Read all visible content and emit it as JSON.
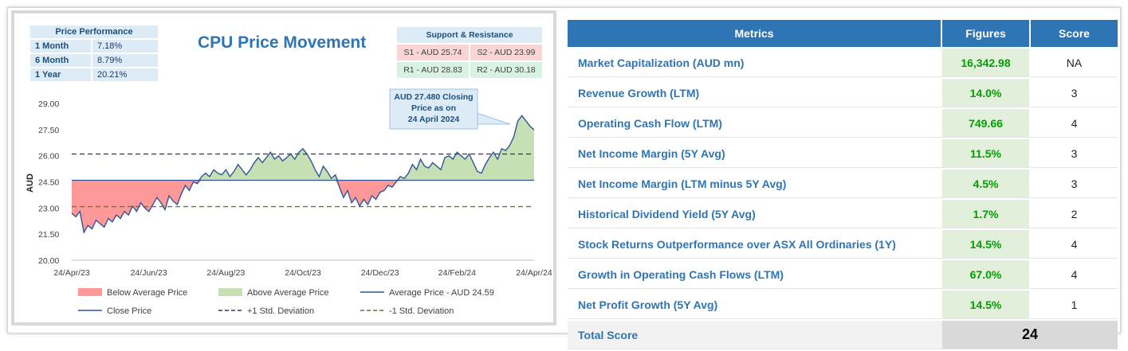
{
  "price_performance": {
    "header": "Price Performance",
    "rows": [
      {
        "label": "1 Month",
        "value": "7.18%"
      },
      {
        "label": "6 Month",
        "value": "8.79%"
      },
      {
        "label": "1 Year",
        "value": "20.21%"
      }
    ]
  },
  "support_resistance": {
    "header": "Support & Resistance",
    "s1": "S1 - AUD 25.74",
    "s2": "S2 - AUD 23.99",
    "r1": "R1 - AUD 28.83",
    "r2": "R2 - AUD 30.18"
  },
  "chart_data": {
    "type": "line",
    "title": "CPU Price Movement",
    "ylabel": "AUD",
    "ylim": [
      20.0,
      29.0
    ],
    "yticks": [
      "20.00",
      "21.50",
      "23.00",
      "24.50",
      "26.00",
      "27.50",
      "29.00"
    ],
    "xticks": [
      "24/Apr/23",
      "24/Jun/23",
      "24/Aug/23",
      "24/Oct/23",
      "24/Dec/23",
      "24/Feb/24",
      "24/Apr/24"
    ],
    "average": 24.59,
    "plus_std": 26.1,
    "minus_std": 23.08,
    "annotation": "AUD 27.480 Closing Price as on 24 April 2024",
    "series": [
      {
        "name": "Close Price",
        "x_range": [
          "24/Apr/23",
          "24/Apr/24"
        ],
        "values": [
          22.7,
          22.5,
          22.8,
          21.6,
          22.0,
          21.8,
          22.3,
          22.1,
          21.9,
          22.4,
          22.2,
          22.6,
          22.4,
          22.8,
          22.6,
          23.1,
          22.8,
          23.3,
          23.0,
          22.8,
          23.2,
          23.6,
          23.3,
          22.9,
          23.7,
          23.4,
          23.2,
          23.8,
          24.3,
          24.0,
          24.5,
          24.4,
          24.8,
          25.0,
          24.8,
          25.2,
          25.0,
          24.9,
          25.2,
          24.8,
          25.1,
          25.5,
          25.2,
          24.9,
          25.2,
          25.6,
          25.9,
          25.6,
          25.9,
          26.2,
          25.8,
          26.0,
          25.7,
          25.9,
          26.1,
          25.8,
          26.2,
          26.4,
          26.1,
          25.7,
          25.2,
          24.8,
          25.4,
          25.1,
          24.7,
          24.9,
          24.2,
          23.6,
          24.0,
          23.3,
          23.6,
          23.1,
          23.5,
          23.2,
          23.7,
          23.5,
          23.9,
          24.0,
          24.3,
          24.2,
          24.5,
          24.8,
          24.7,
          25.0,
          25.5,
          25.2,
          25.8,
          25.4,
          25.3,
          25.6,
          25.4,
          25.2,
          25.9,
          26.0,
          25.8,
          26.2,
          26.0,
          25.8,
          26.1,
          25.6,
          25.1,
          25.0,
          25.5,
          25.9,
          26.2,
          25.8,
          26.4,
          26.3,
          26.6,
          27.1,
          28.0,
          28.3,
          28.0,
          27.7,
          27.48
        ],
        "color": "#2f5597"
      }
    ],
    "legend": [
      {
        "label": "Below Average Price",
        "kind": "swatch",
        "color": "#ff9999"
      },
      {
        "label": "Above Average Price",
        "kind": "swatch",
        "color": "#c6e0b4"
      },
      {
        "label": "Average Price - AUD 24.59",
        "kind": "solid",
        "color": "#2f5597"
      },
      {
        "label": "Close Price",
        "kind": "solid",
        "color": "#2f5597"
      },
      {
        "label": "+1 Std. Deviation",
        "kind": "dash",
        "color": "#1f3864"
      },
      {
        "label": "-1 Std. Deviation",
        "kind": "dash",
        "color": "#548235"
      }
    ]
  },
  "metrics_table": {
    "headers": [
      "Metrics",
      "Figures",
      "Score"
    ],
    "rows": [
      {
        "metric": "Market Capitalization (AUD mn)",
        "figure": "16,342.98",
        "score": "NA"
      },
      {
        "metric": "Revenue Growth (LTM)",
        "figure": "14.0%",
        "score": "3"
      },
      {
        "metric": "Operating Cash Flow (LTM)",
        "figure": "749.66",
        "score": "4"
      },
      {
        "metric": "Net Income Margin (5Y Avg)",
        "figure": "11.5%",
        "score": "3"
      },
      {
        "metric": "Net Income Margin (LTM minus 5Y Avg)",
        "figure": "4.5%",
        "score": "3"
      },
      {
        "metric": "Historical Dividend Yield (5Y Avg)",
        "figure": "1.7%",
        "score": "2"
      },
      {
        "metric": "Stock Returns Outperformance over ASX All Ordinaries (1Y)",
        "figure": "14.5%",
        "score": "4"
      },
      {
        "metric": "Growth in Operating Cash Flows (LTM)",
        "figure": "67.0%",
        "score": "4"
      },
      {
        "metric": "Net Profit Growth (5Y Avg)",
        "figure": "14.5%",
        "score": "1"
      }
    ],
    "total_label": "Total Score",
    "total_value": "24"
  }
}
